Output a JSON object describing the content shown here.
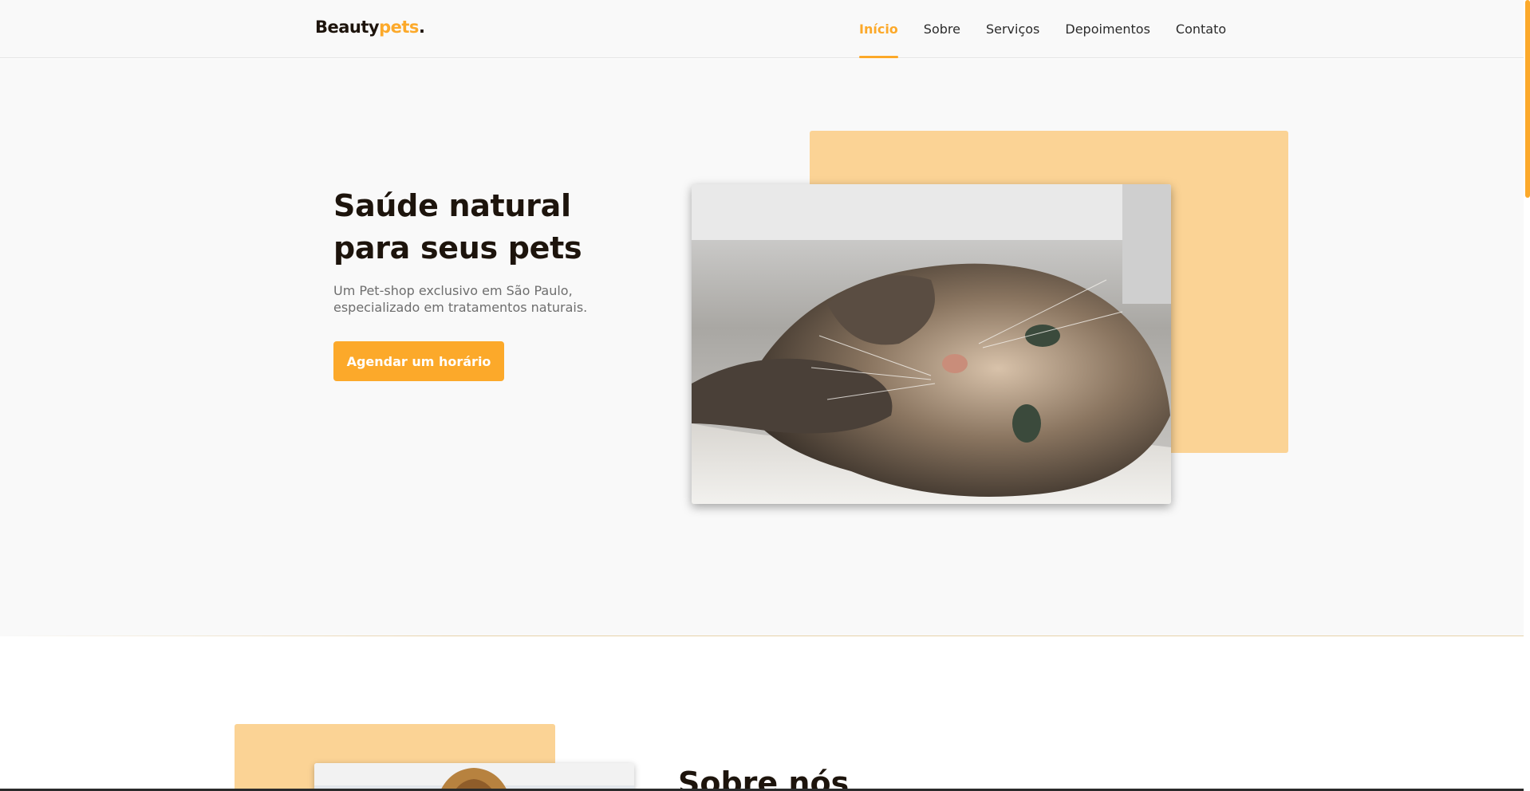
{
  "brand": {
    "name": "Beauty",
    "accent": "pets",
    "dot": "."
  },
  "nav": {
    "items": [
      {
        "label": "Início",
        "active": true
      },
      {
        "label": "Sobre",
        "active": false
      },
      {
        "label": "Serviços",
        "active": false
      },
      {
        "label": "Depoimentos",
        "active": false
      },
      {
        "label": "Contato",
        "active": false
      }
    ]
  },
  "hero": {
    "title": "Saúde natural para seus pets",
    "subtitle": "Um Pet-shop exclusivo em São Paulo, especializado em tratamentos naturais.",
    "cta_label": "Agendar um horário"
  },
  "about": {
    "title": "Sobre nós"
  },
  "colors": {
    "accent": "#fca92a",
    "accent_light": "#fbd395",
    "dark_text": "#1d140c",
    "muted_text": "#6e6e6e",
    "background": "#f9f9f9"
  }
}
